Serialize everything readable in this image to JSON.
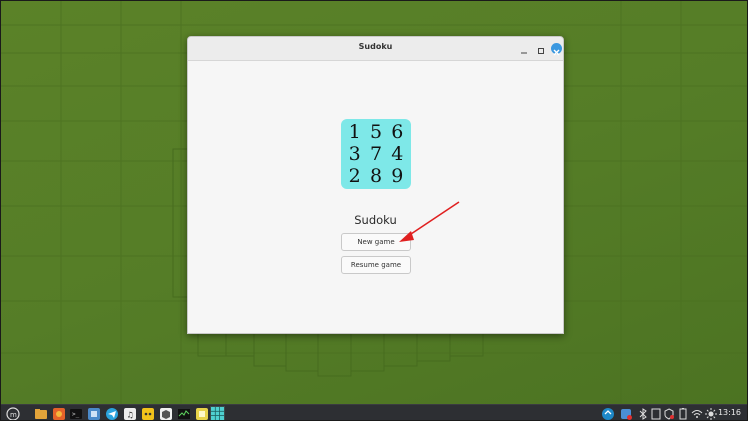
{
  "window": {
    "title": "Sudoku",
    "app_name": "Sudoku",
    "logo_digits": [
      "1",
      "5",
      "6",
      "3",
      "7",
      "4",
      "2",
      "8",
      "9"
    ],
    "logo_color": "#7ee8e8",
    "buttons": {
      "new_game": "New game",
      "resume_game": "Resume game"
    },
    "close_button_color": "#3a98e0"
  },
  "annotation": {
    "arrow_color": "#e02020",
    "points_to": "new-game-button"
  },
  "taskbar": {
    "clock": "13:16",
    "launchers": [
      "mint-menu-icon",
      "files-icon",
      "firefox-icon",
      "terminal-icon",
      "app-icon",
      "telegram-icon",
      "music-icon",
      "game-icon",
      "package-icon",
      "system-monitor-icon",
      "notes-icon",
      "sudoku-icon"
    ],
    "tray": [
      "update-icon",
      "update-manager-icon",
      "bluetooth-icon",
      "clipboard-icon",
      "shield-icon",
      "battery-icon",
      "wifi-icon",
      "brightness-icon"
    ]
  }
}
